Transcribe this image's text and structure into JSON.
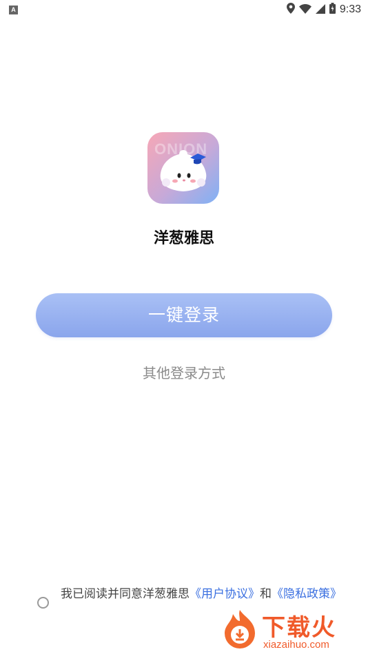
{
  "status_bar": {
    "left_badge": "A",
    "time": "9:33",
    "icons": [
      "location-icon",
      "wifi-icon",
      "signal-icon",
      "battery-icon"
    ]
  },
  "logo": {
    "watermark": "ONION",
    "colors": [
      "#f7a7b6",
      "#c7a9d8",
      "#7fb1f5"
    ]
  },
  "app_name": "洋葱雅思",
  "login": {
    "primary_label": "一键登录",
    "other_label": "其他登录方式"
  },
  "agreement": {
    "prefix": "我已阅读并同意洋葱雅思",
    "user_agreement": "《用户协议》",
    "and": "和",
    "privacy_policy": "《隐私政策》"
  },
  "watermark": {
    "text": "下载火",
    "url": "xiazaihuo.com"
  },
  "colors": {
    "button": "#8aa5ec",
    "link": "#3a6fe0",
    "watermark": "#f05a2a"
  }
}
